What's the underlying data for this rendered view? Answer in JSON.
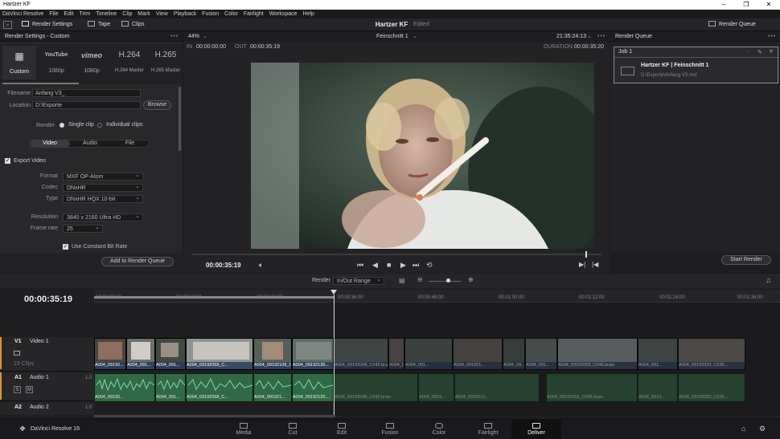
{
  "window": {
    "title": "Hartzer KF",
    "controls": [
      "–",
      "❐",
      "✕"
    ]
  },
  "menu": [
    "DaVinci Resolve",
    "File",
    "Edit",
    "Trim",
    "Timeline",
    "Clip",
    "Mark",
    "View",
    "Playback",
    "Fusion",
    "Color",
    "Fairlight",
    "Workspace",
    "Help"
  ],
  "toolbar": {
    "render_settings": "Render Settings",
    "tape": "Tape",
    "clips": "Clips",
    "project_title": "Hartzer KF",
    "edited": "Edited",
    "render_queue": "Render Queue"
  },
  "render_settings": {
    "title": "Render Settings - Custom",
    "presets": [
      {
        "icon": "▦",
        "label": "Custom"
      },
      {
        "icon": "YouTube",
        "label": "1080p"
      },
      {
        "icon": "vimeo",
        "label": "1080p"
      },
      {
        "icon": "H.264",
        "label": "H.264 Master"
      },
      {
        "icon": "H.265",
        "label": "H.265 Master"
      }
    ],
    "filename_label": "Filename",
    "filename": "Anfang V3_",
    "location_label": "Location",
    "location": "D:\\Exporte",
    "browse": "Browse",
    "render_label": "Render",
    "single_clip": "Single clip",
    "individual_clips": "Individual clips",
    "tabs": [
      "Video",
      "Audio",
      "File"
    ],
    "export_video": "Export Video",
    "format_label": "Format",
    "format": "MXF OP-Atom",
    "codec_label": "Codec",
    "codec": "DNxHR",
    "type_label": "Type",
    "type": "DNxHR HQX 10-bit",
    "resolution_label": "Resolution",
    "resolution": "3840 x 2160 Ultra HD",
    "framerate_label": "Frame rate",
    "framerate": "25",
    "constant_bitrate": "Use Constant Bit Rate",
    "add_to_queue": "Add to Render Queue"
  },
  "viewer": {
    "zoom": "44%",
    "timeline_name": "Feinschnitt 1",
    "timecode": "21:35:24:13",
    "in_label": "IN",
    "in": "00:00:00:00",
    "out_label": "OUT",
    "out": "00:00:35:19",
    "duration_label": "DURATION",
    "duration": "00:00:35:20",
    "current": "00:00:35:19"
  },
  "render_queue": {
    "title": "Render Queue",
    "job": "Job 1",
    "job_title": "Hartzer KF | Feinschnitt 1",
    "job_path": "D:\\Exporte\\Anfang V3.mxf",
    "start_render": "Start Render"
  },
  "timeline": {
    "timecode": "00:00:35:19",
    "render_label": "Render",
    "render_mode": "In/Out Range",
    "ruler": [
      "00:00:00:00",
      "00:00:12:00",
      "00:00:24:00",
      "00:00:36:00",
      "00:00:48:00",
      "00:01:00:00",
      "00:01:12:00",
      "00:01:24:00",
      "00:01:36:00"
    ],
    "tracks": {
      "v1": "V1",
      "v1_name": "Video 1",
      "v1_clips": "19 Clips",
      "a1": "A1",
      "a1_name": "Audio 1",
      "a1_level": "1.0",
      "a2": "A2",
      "a2_name": "Audio 2",
      "a2_level": "1.0",
      "solo": "S",
      "mute": "M"
    },
    "video_clips": [
      "A004_09192...",
      "A004_091...",
      "A004_091...",
      "A004_09192058_C...",
      "A004_09192108_C047.br...",
      "A004_09192135...",
      "A004_09192048_C042.braw",
      "A004_091...",
      "A004_091...",
      "A004_091921...",
      "A004_09...",
      "A004_091...",
      "A004_09192058_C046.braw",
      "A004_091...",
      "A004_09192033_C039..."
    ],
    "audio_clips": [
      "A004_09192...",
      "A004_091...",
      "A004_09192058_C...",
      "A004_091921...",
      "A004_09192135...",
      "A004_09192048_C042.braw",
      "A004_0919...",
      "A004_0919212...",
      "A004_09192058_C046.braw",
      "A004_0919...",
      "A004_09192033_C039..."
    ]
  },
  "pages": {
    "app": "DaVinci Resolve 16",
    "items": [
      "Media",
      "Cut",
      "Edit",
      "Fusion",
      "Color",
      "Fairlight",
      "Deliver"
    ],
    "active": "Deliver"
  }
}
